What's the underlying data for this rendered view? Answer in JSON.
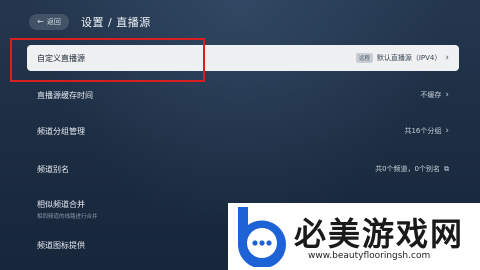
{
  "header": {
    "back_label": "返回",
    "title": "设置 / 直播源"
  },
  "rows": [
    {
      "label": "自定义直播源",
      "badge": "远程",
      "value": "默认直播源（IPV4）"
    },
    {
      "label": "直播源缓存时间",
      "value": "不缓存"
    },
    {
      "label": "频道分组管理",
      "value": "共16个分组"
    },
    {
      "label": "频道别名",
      "value": "共0个频道，0个别名"
    },
    {
      "label": "相似频道合并",
      "sublabel": "相同频道的线路进行合并"
    },
    {
      "label": "频道图标提供"
    }
  ],
  "watermark": {
    "title": "必美游戏网",
    "url": "www.beautyflooringsh.com"
  },
  "colors": {
    "highlight": "#d81e1e",
    "brand_blue": "#1e63d6"
  }
}
